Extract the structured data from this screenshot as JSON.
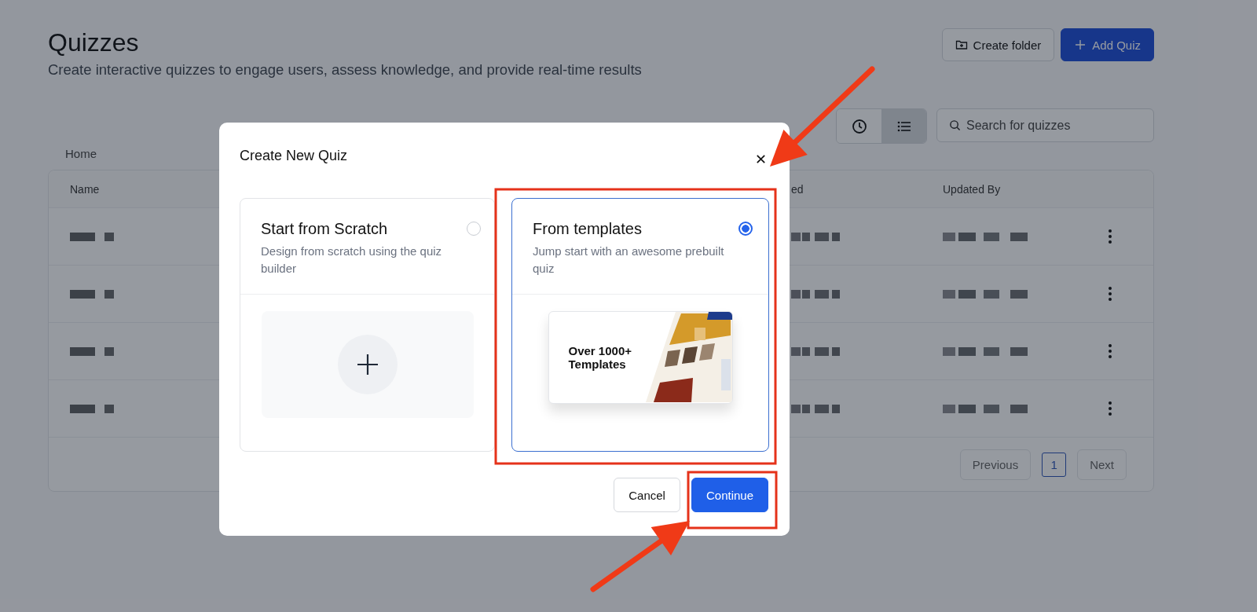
{
  "page": {
    "title": "Quizzes",
    "subtitle": "Create interactive quizzes to engage users, assess knowledge, and provide real-time results"
  },
  "actions": [
    {
      "label": "Create folder",
      "kind": "secondary"
    },
    {
      "label": "Add Quiz",
      "kind": "primary"
    }
  ],
  "view_toggle": [
    {
      "kind": "clock",
      "selected": false
    },
    {
      "kind": "list",
      "selected": true
    }
  ],
  "search": {
    "placeholder": "Search for quizzes"
  },
  "breadcrumb": "Home",
  "table": {
    "columns": [
      {
        "label": "Name"
      },
      {
        "label": "ed"
      },
      {
        "label": "Updated By"
      }
    ],
    "rows": [
      {
        "kind": "redacted"
      },
      {
        "kind": "redacted"
      },
      {
        "kind": "redacted"
      },
      {
        "kind": "redacted"
      }
    ],
    "pagination": {
      "previous": "Previous",
      "pages": [
        {
          "label": "1",
          "selected": true
        }
      ],
      "next": "Next"
    }
  },
  "dialog": {
    "title": "Create New Quiz",
    "options": [
      {
        "kind": "scratch",
        "title": "Start from Scratch",
        "description": "Design from scratch using the quiz builder",
        "selected": false
      },
      {
        "kind": "templates",
        "title": "From templates",
        "description": "Jump start with an awesome prebuilt quiz",
        "preview_text": "Over 1000+ Templates",
        "selected": true
      }
    ],
    "buttons": [
      {
        "label": "Cancel",
        "kind": "secondary"
      },
      {
        "label": "Continue",
        "kind": "primary"
      }
    ]
  },
  "annotations": [
    {
      "kind": "arrow"
    },
    {
      "kind": "highlight"
    },
    {
      "kind": "highlight"
    },
    {
      "kind": "arrow"
    }
  ]
}
